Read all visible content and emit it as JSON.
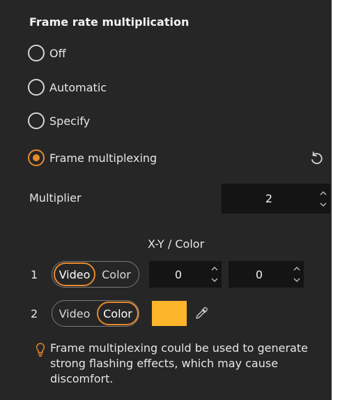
{
  "section": {
    "title": "Frame rate multiplication"
  },
  "options": [
    {
      "label": "Off",
      "selected": false
    },
    {
      "label": "Automatic",
      "selected": false
    },
    {
      "label": "Specify",
      "selected": false
    },
    {
      "label": "Frame multiplexing",
      "selected": true
    }
  ],
  "multiplier": {
    "label": "Multiplier",
    "value": "2"
  },
  "table": {
    "header": "X-Y / Color",
    "rows": [
      {
        "index": "1",
        "video_label": "Video",
        "color_label": "Color",
        "mode": "Video",
        "x": "0",
        "y": "0"
      },
      {
        "index": "2",
        "video_label": "Video",
        "color_label": "Color",
        "mode": "Color",
        "color": "#fdb52b"
      }
    ]
  },
  "tip": {
    "text": "Frame multiplexing could be used to generate strong flashing effects, which may cause discomfort."
  },
  "colors": {
    "accent": "#e88a2c",
    "panel": "#262626",
    "field": "#141414"
  },
  "icons": {
    "reset": "reset-icon",
    "eyedropper": "eyedropper-icon",
    "tip": "lightbulb-icon"
  }
}
